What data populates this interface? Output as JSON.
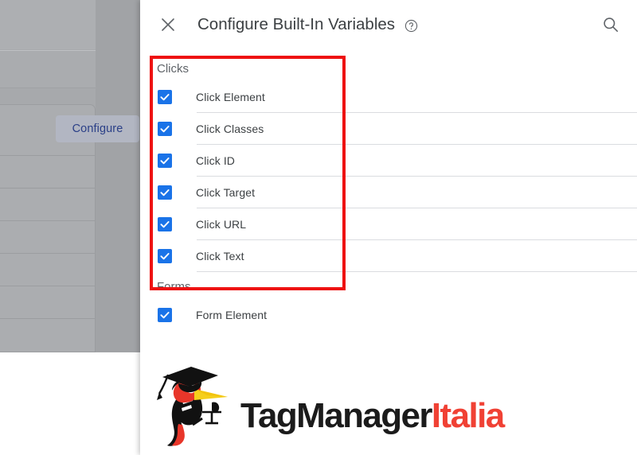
{
  "background_app": {
    "configure_button_label": "Configure",
    "row_count": 6
  },
  "panel": {
    "title": "Configure Built-In Variables",
    "close_icon": "close-icon",
    "help_icon": "help-circle-icon",
    "search_icon": "search-icon",
    "groups": [
      {
        "name": "Clicks",
        "items": [
          {
            "label": "Click Element",
            "checked": true
          },
          {
            "label": "Click Classes",
            "checked": true
          },
          {
            "label": "Click ID",
            "checked": true
          },
          {
            "label": "Click Target",
            "checked": true
          },
          {
            "label": "Click URL",
            "checked": true
          },
          {
            "label": "Click Text",
            "checked": true
          }
        ]
      },
      {
        "name": "Forms",
        "items": [
          {
            "label": "Form Element",
            "checked": true
          }
        ]
      }
    ]
  },
  "annotation": {
    "shape": "rectangle",
    "color": "#ee1111",
    "targets": "Clicks"
  },
  "logo": {
    "text_primary": "TagManager",
    "text_accent": "Italia",
    "icon": "woodpecker-graduate-icon",
    "colors": {
      "primary": "#1b1b1b",
      "accent": "#f04134",
      "bird_red": "#e8362a",
      "bird_yellow": "#f5cf1c",
      "bird_black": "#111111"
    }
  },
  "colors": {
    "checkbox_blue": "#1a73e8",
    "divider": "#dadce0",
    "title_text": "#3c4043",
    "secondary_text": "#5f6368",
    "scrim": "#a7a9ac"
  }
}
